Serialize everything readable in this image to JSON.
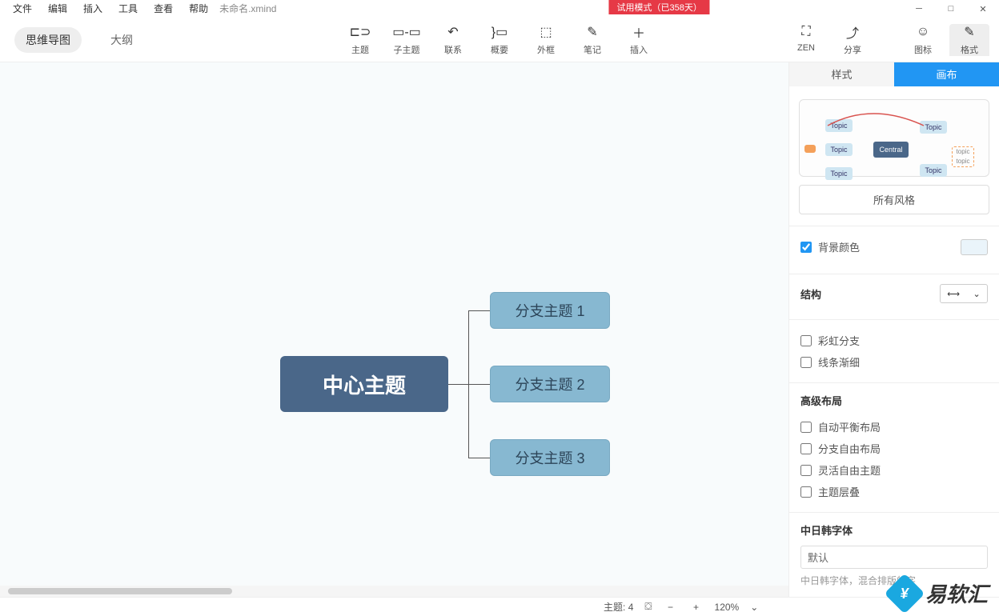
{
  "menubar": {
    "items": [
      "文件",
      "编辑",
      "插入",
      "工具",
      "查看",
      "帮助"
    ],
    "filename": "未命名.xmind"
  },
  "trial_badge": "试用模式（已358天）",
  "view_tabs": {
    "mindmap": "思维导图",
    "outline": "大纲"
  },
  "toolbar": {
    "topic": "主题",
    "subtopic": "子主题",
    "relation": "联系",
    "summary": "概要",
    "boundary": "外框",
    "note": "笔记",
    "insert": "插入",
    "zen": "ZEN",
    "share": "分享",
    "icons": "图标",
    "format": "格式"
  },
  "mindmap": {
    "central": "中心主题",
    "branches": [
      "分支主题 1",
      "分支主题 2",
      "分支主题 3"
    ]
  },
  "sidebar": {
    "tab_style": "样式",
    "tab_canvas": "画布",
    "preview": {
      "central": "Central",
      "topic": "Topic",
      "sub": "topic"
    },
    "all_styles": "所有风格",
    "bg_color_label": "背景颜色",
    "structure_label": "结构",
    "rainbow": "彩虹分支",
    "tapered": "线条渐细",
    "adv_layout_title": "高级布局",
    "auto_balance": "自动平衡布局",
    "free_branch": "分支自由布局",
    "free_topic": "灵活自由主题",
    "overlap": "主题层叠",
    "cjk_font_title": "中日韩字体",
    "cjk_default": "默认",
    "cjk_hint": "中日韩字体，混合排版的字"
  },
  "statusbar": {
    "topic_label": "主题:",
    "topic_count": "4",
    "zoom": "120%"
  },
  "watermark": "易软汇"
}
